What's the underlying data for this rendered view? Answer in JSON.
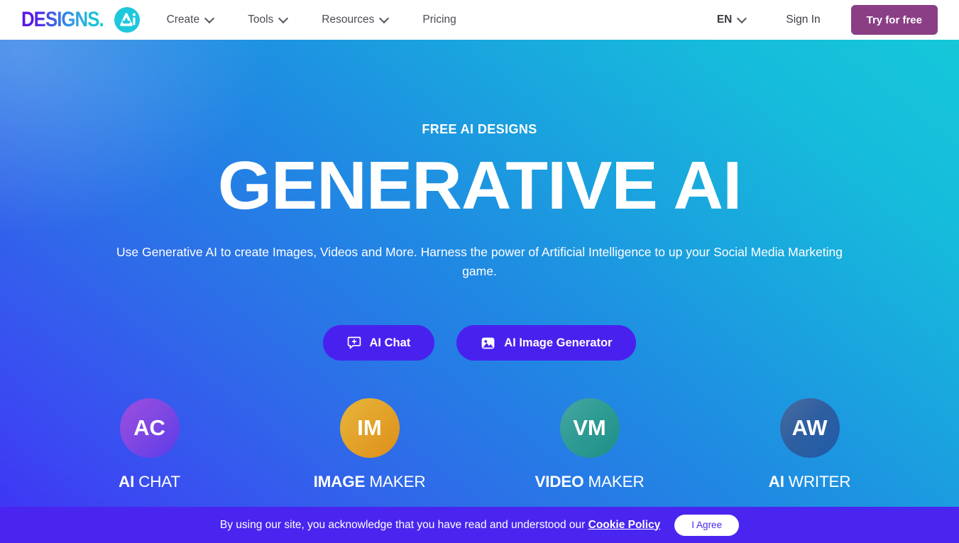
{
  "header": {
    "logo": {
      "word": "DESIGNS.",
      "mark_icon": "ai-circle-icon",
      "alt": "Designs.AI"
    },
    "nav_items": [
      {
        "label": "Create",
        "has_dropdown": true,
        "icon": "chevron-down-icon"
      },
      {
        "label": "Tools",
        "has_dropdown": true,
        "icon": "chevron-down-icon"
      },
      {
        "label": "Resources",
        "has_dropdown": true,
        "icon": "chevron-down-icon"
      },
      {
        "label": "Pricing",
        "has_dropdown": false,
        "icon": ""
      }
    ],
    "language": {
      "label": "EN",
      "icon": "chevron-down-icon"
    },
    "sign_in_label": "Sign In",
    "try_label": "Try for free",
    "try_color": "#8a3f85"
  },
  "hero": {
    "eyebrow": "FREE AI DESIGNS",
    "headline": "GENERATIVE AI",
    "subhead": "Use Generative AI to create Images, Videos and More. Harness the power of Artificial Intelligence to up your Social Media Marketing game.",
    "gradient_from": "#4030f5",
    "gradient_mid": "#2088e3",
    "gradient_to": "#15c7d9",
    "cta_color": "#4921ef",
    "buttons": [
      {
        "label": "AI Chat",
        "icon": "chat-plus-icon"
      },
      {
        "label": "AI Image Generator",
        "icon": "image-icon"
      }
    ],
    "tiles": [
      {
        "initials": "AC",
        "strong": "AI",
        "rest": " CHAT",
        "color": "#8248e2"
      },
      {
        "initials": "IM",
        "strong": "IMAGE",
        "rest": " MAKER",
        "color": "#e3a42c"
      },
      {
        "initials": "VM",
        "strong": "VIDEO",
        "rest": " MAKER",
        "color": "#2f9c94"
      },
      {
        "initials": "AW",
        "strong": "AI",
        "rest": " WRITER",
        "color": "#2f5fa0"
      }
    ]
  },
  "cookie": {
    "text_before": "By using our site, you acknowledge that you have read and understood our",
    "link_label": "Cookie Policy",
    "agree_label": "I Agree",
    "background": "#4a25ef"
  }
}
